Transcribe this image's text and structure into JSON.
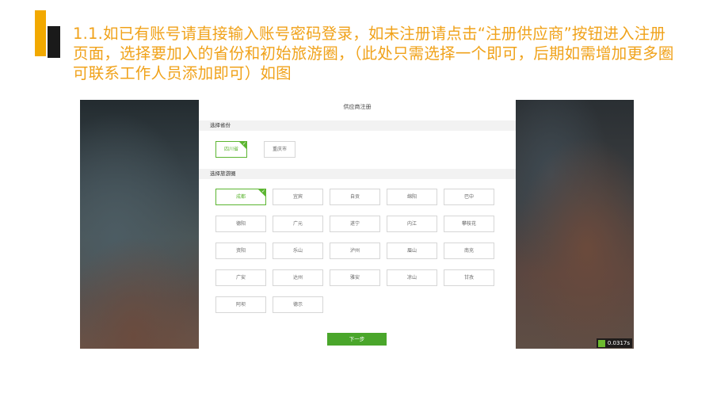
{
  "slide": {
    "heading": "1.1.如已有账号请直接输入账号密码登录，如未注册请点击“注册供应商”按钮进入注册页面，选择要加入的省份和初始旅游圈，（此处只需选择一个即可，后期如需增加更多圈可联系工作人员添加即可）如图"
  },
  "colors": {
    "accent_gold": "#f2a900",
    "heading_text": "#f0a21a",
    "green": "#5cb531",
    "button_green": "#4aa62b"
  },
  "form": {
    "title": "供应商注册",
    "province_section": "选择省份",
    "provinces": [
      {
        "label": "四川省",
        "selected": true
      },
      {
        "label": "重庆市",
        "selected": false
      }
    ],
    "circle_section": "选择旅游圈",
    "circles": [
      {
        "label": "成都",
        "selected": true
      },
      {
        "label": "宜宾",
        "selected": false
      },
      {
        "label": "自贡",
        "selected": false
      },
      {
        "label": "绵阳",
        "selected": false
      },
      {
        "label": "巴中",
        "selected": false
      },
      {
        "label": "德阳",
        "selected": false
      },
      {
        "label": "广元",
        "selected": false
      },
      {
        "label": "遂宁",
        "selected": false
      },
      {
        "label": "内江",
        "selected": false
      },
      {
        "label": "攀枝花",
        "selected": false
      },
      {
        "label": "资阳",
        "selected": false
      },
      {
        "label": "乐山",
        "selected": false
      },
      {
        "label": "泸州",
        "selected": false
      },
      {
        "label": "眉山",
        "selected": false
      },
      {
        "label": "南充",
        "selected": false
      },
      {
        "label": "广安",
        "selected": false
      },
      {
        "label": "达州",
        "selected": false
      },
      {
        "label": "雅安",
        "selected": false
      },
      {
        "label": "凉山",
        "selected": false
      },
      {
        "label": "甘孜",
        "selected": false
      },
      {
        "label": "阿坝",
        "selected": false
      },
      {
        "label": "德示",
        "selected": false
      }
    ],
    "next_label": "下一步"
  },
  "video_badge": {
    "time": "0.0317s",
    "icon": "app-logo-icon"
  }
}
